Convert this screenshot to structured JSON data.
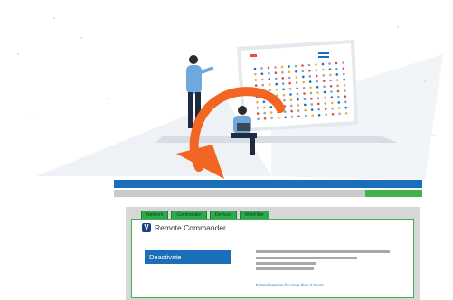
{
  "tabs": [
    {
      "label": "Network"
    },
    {
      "label": "Commander"
    },
    {
      "label": "Devices"
    },
    {
      "label": "WebFilter"
    }
  ],
  "app": {
    "logo_letter": "V",
    "title": "Remote Commander"
  },
  "actions": {
    "deactivate_label": "Deactivate",
    "extend_link": "Extend session for more than 2 hours"
  },
  "colors": {
    "accent_blue": "#1a6fb8",
    "accent_green": "#3db34a",
    "arrow_orange": "#f26522"
  }
}
